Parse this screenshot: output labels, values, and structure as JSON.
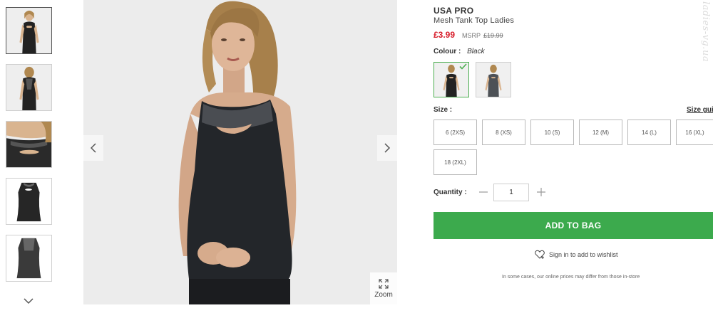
{
  "gallery": {
    "thumbnails": [
      {
        "label": "front view",
        "selected": true
      },
      {
        "label": "back view",
        "selected": false
      },
      {
        "label": "mesh detail",
        "selected": false
      },
      {
        "label": "flat front",
        "selected": false
      },
      {
        "label": "flat back",
        "selected": false
      }
    ],
    "zoom_label": "Zoom"
  },
  "product": {
    "brand": "USA PRO",
    "name": "Mesh Tank Top Ladies",
    "price": "£3.99",
    "msrp_label": "MSRP",
    "msrp_value": "£19.99",
    "price_color": "#d71d2a"
  },
  "colour": {
    "label": "Colour :",
    "value": "Black",
    "swatches": [
      "Black",
      "Grey"
    ],
    "selected_color": "#4caf50"
  },
  "size": {
    "label": "Size :",
    "guide_label": "Size guide",
    "options": [
      "6 (2XS)",
      "8 (XS)",
      "10 (S)",
      "12 (M)",
      "14 (L)",
      "16 (XL)",
      "18 (2XL)"
    ]
  },
  "quantity": {
    "label": "Quantity :",
    "value": "1"
  },
  "actions": {
    "add_to_bag": "ADD TO BAG",
    "add_color": "#3caa4d",
    "wishlist": "Sign in to add to wishlist"
  },
  "disclaimer": "In some cases, our online prices may differ from those in-store",
  "watermark": "ladies-vg.ua"
}
